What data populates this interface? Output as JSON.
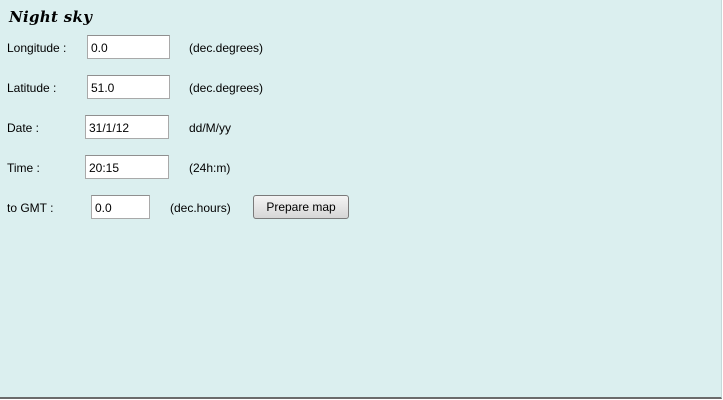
{
  "title": "Night sky",
  "fields": [
    {
      "label": "Longitude :",
      "value": "0.0",
      "unit": "(dec.degrees)"
    },
    {
      "label": "Latitude :",
      "value": "51.0",
      "unit": "(dec.degrees)"
    },
    {
      "label": "Date :",
      "value": "31/1/12",
      "unit": "dd/M/yy"
    },
    {
      "label": "Time :",
      "value": "20:15",
      "unit": "(24h:m)"
    },
    {
      "label": "to GMT :",
      "value": "0.0",
      "unit": "(dec.hours)"
    }
  ],
  "prepare_button": "Prepare map",
  "colors": {
    "background": "#dbefef",
    "bottom_border": "#6b6b6b"
  }
}
